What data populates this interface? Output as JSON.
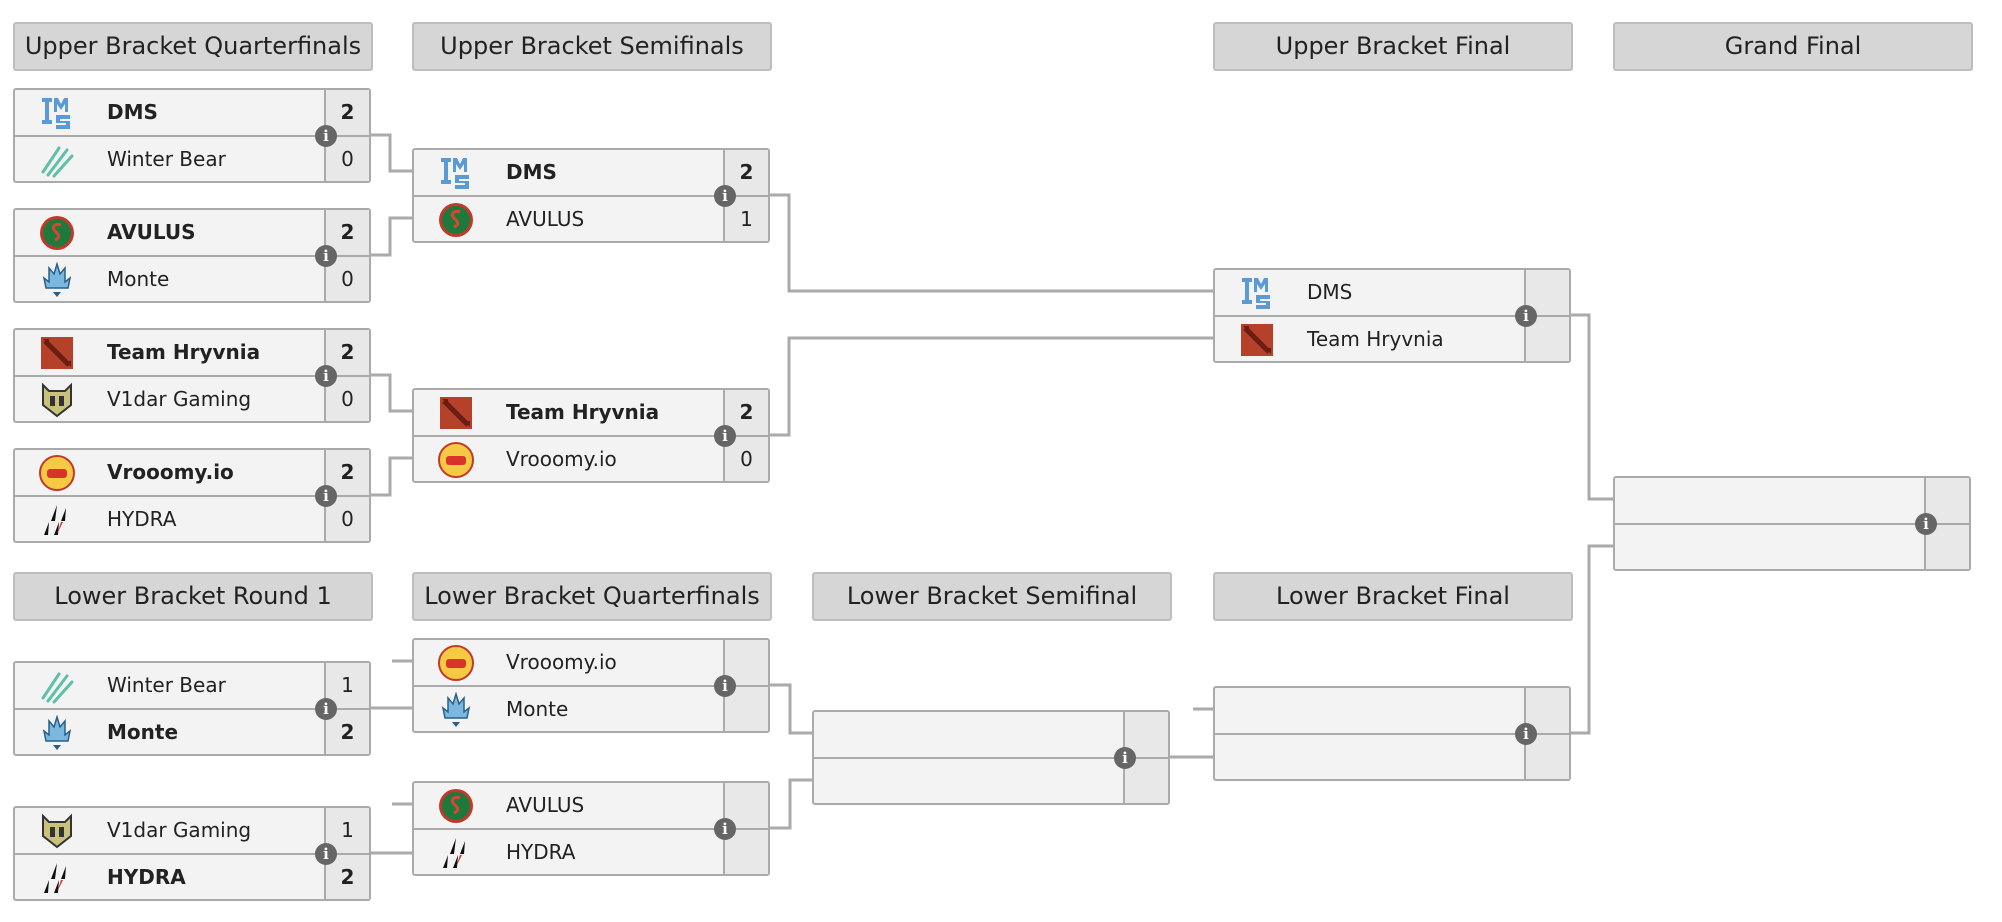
{
  "headers": {
    "ubqf": "Upper Bracket Quarterfinals",
    "ubsf": "Upper Bracket Semifinals",
    "ubf": "Upper Bracket Final",
    "gf": "Grand Final",
    "lbr1": "Lower Bracket Round 1",
    "lbqf": "Lower Bracket Quarterfinals",
    "lbsf": "Lower Bracket Semifinal",
    "lbf": "Lower Bracket Final"
  },
  "info_glyph": "i",
  "colors": {
    "header_bg": "#d6d6d6",
    "match_bg": "#f3f3f3",
    "border": "#aaaaaa",
    "info": "#666666"
  },
  "matches": [
    {
      "id": "ubqf1",
      "teams": [
        {
          "name": "DMS",
          "logo": "dms",
          "score": "2",
          "win": true
        },
        {
          "name": "Winter Bear",
          "logo": "winterbear",
          "score": "0"
        }
      ]
    },
    {
      "id": "ubqf2",
      "teams": [
        {
          "name": "AVULUS",
          "logo": "avulus",
          "score": "2",
          "win": true
        },
        {
          "name": "Monte",
          "logo": "monte",
          "score": "0"
        }
      ]
    },
    {
      "id": "ubqf3",
      "teams": [
        {
          "name": "Team Hryvnia",
          "logo": "hryvnia",
          "score": "2",
          "win": true
        },
        {
          "name": "V1dar Gaming",
          "logo": "v1dar",
          "score": "0"
        }
      ]
    },
    {
      "id": "ubqf4",
      "teams": [
        {
          "name": "Vrooomy.io",
          "logo": "vrooomy",
          "score": "2",
          "win": true
        },
        {
          "name": "HYDRA",
          "logo": "hydra",
          "score": "0"
        }
      ]
    },
    {
      "id": "ubsf1",
      "teams": [
        {
          "name": "DMS",
          "logo": "dms",
          "score": "2",
          "win": true
        },
        {
          "name": "AVULUS",
          "logo": "avulus",
          "score": "1"
        }
      ]
    },
    {
      "id": "ubsf2",
      "teams": [
        {
          "name": "Team Hryvnia",
          "logo": "hryvnia",
          "score": "2",
          "win": true
        },
        {
          "name": "Vrooomy.io",
          "logo": "vrooomy",
          "score": "0"
        }
      ]
    },
    {
      "id": "ubf",
      "teams": [
        {
          "name": "DMS",
          "logo": "dms",
          "score": ""
        },
        {
          "name": "Team Hryvnia",
          "logo": "hryvnia",
          "score": ""
        }
      ]
    },
    {
      "id": "gf",
      "teams": [
        {
          "name": "",
          "logo": "",
          "score": ""
        },
        {
          "name": "",
          "logo": "",
          "score": ""
        }
      ]
    },
    {
      "id": "lbr1a",
      "teams": [
        {
          "name": "Winter Bear",
          "logo": "winterbear",
          "score": "1"
        },
        {
          "name": "Monte",
          "logo": "monte",
          "score": "2",
          "win": true
        }
      ]
    },
    {
      "id": "lbr1b",
      "teams": [
        {
          "name": "V1dar Gaming",
          "logo": "v1dar",
          "score": "1"
        },
        {
          "name": "HYDRA",
          "logo": "hydra",
          "score": "2",
          "win": true
        }
      ]
    },
    {
      "id": "lbqf1",
      "teams": [
        {
          "name": "Vrooomy.io",
          "logo": "vrooomy",
          "score": ""
        },
        {
          "name": "Monte",
          "logo": "monte",
          "score": ""
        }
      ]
    },
    {
      "id": "lbqf2",
      "teams": [
        {
          "name": "AVULUS",
          "logo": "avulus",
          "score": ""
        },
        {
          "name": "HYDRA",
          "logo": "hydra",
          "score": ""
        }
      ]
    },
    {
      "id": "lbsf",
      "teams": [
        {
          "name": "",
          "logo": "",
          "score": ""
        },
        {
          "name": "",
          "logo": "",
          "score": ""
        }
      ]
    },
    {
      "id": "lbf",
      "teams": [
        {
          "name": "",
          "logo": "",
          "score": ""
        },
        {
          "name": "",
          "logo": "",
          "score": ""
        }
      ]
    }
  ]
}
